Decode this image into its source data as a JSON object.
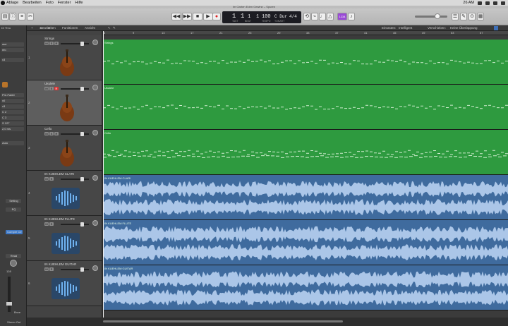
{
  "menubar": {
    "items": [
      "Ablage",
      "Bearbeiten",
      "Foto",
      "Fenster",
      "Hilfe"
    ],
    "time": "26 AM"
  },
  "window": {
    "title": "Im Garten Eden Gewinn – Spuren"
  },
  "toolbar": {
    "lcd": {
      "bar": "1",
      "beat": "1",
      "div": "1",
      "tick": "1",
      "tempo": "100",
      "key": "C Dur",
      "signature": "4/4",
      "labels": [
        "TAKT",
        "BEAT",
        "TEMPO",
        "TONART"
      ]
    },
    "cpu_label": "1234"
  },
  "inspector": {
    "title": "Dl Thru",
    "fields": [
      "ave",
      "nfo",
      "x3",
      "Pre-Fader",
      "x0",
      "x3",
      "C 2",
      "C 3",
      "S 127",
      "2,0 ms",
      "Auto"
    ],
    "buttons": [
      "Setting",
      "EQ",
      "Compre Ctr",
      "Read"
    ],
    "value_a": "128",
    "bottom_labels": [
      "Bnce",
      "Stereo Out"
    ]
  },
  "header_bar": {
    "menus": [
      "Bearbeiten",
      "Funktionen",
      "Ansicht"
    ],
    "snap_label": "Einrasten:",
    "snap_value": "Intelligent",
    "drag_label": "Verschieben:",
    "drag_value": "Keine Überlappung"
  },
  "ruler": {
    "ticks": [
      "5",
      "9",
      "13",
      "17",
      "21",
      "25",
      "29",
      "33",
      "37",
      "41",
      "45",
      "49",
      "53",
      "57"
    ]
  },
  "tracks": [
    {
      "num": "1",
      "name": "Strings",
      "type": "midi",
      "icon": "cello-icon",
      "region": "Strings"
    },
    {
      "num": "2",
      "name": "Ukulele",
      "type": "midi",
      "icon": "mandolin-icon",
      "region": "Ukulele",
      "selected": true,
      "rec": true
    },
    {
      "num": "3",
      "name": "Cello",
      "type": "midi",
      "icon": "violin-icon",
      "region": "Cello"
    },
    {
      "num": "4",
      "name": "IN KUEHLEM CLARI",
      "type": "audio",
      "icon": "waveform-icon",
      "region": "IN KUEHLEM CLARI"
    },
    {
      "num": "5",
      "name": "IN KUEHLEM FLUTE",
      "type": "audio",
      "icon": "waveform-icon",
      "region": "IN KUEHLEM FLUTE"
    },
    {
      "num": "6",
      "name": "IN KUEHLEM GUITAR",
      "type": "audio",
      "icon": "waveform-icon",
      "region": "IN KUEHLEM GUITAR"
    }
  ],
  "colors": {
    "midi_region": "#2e9a3f",
    "audio_region": "#3f6b9e",
    "waveform": "#b7d0ef"
  }
}
